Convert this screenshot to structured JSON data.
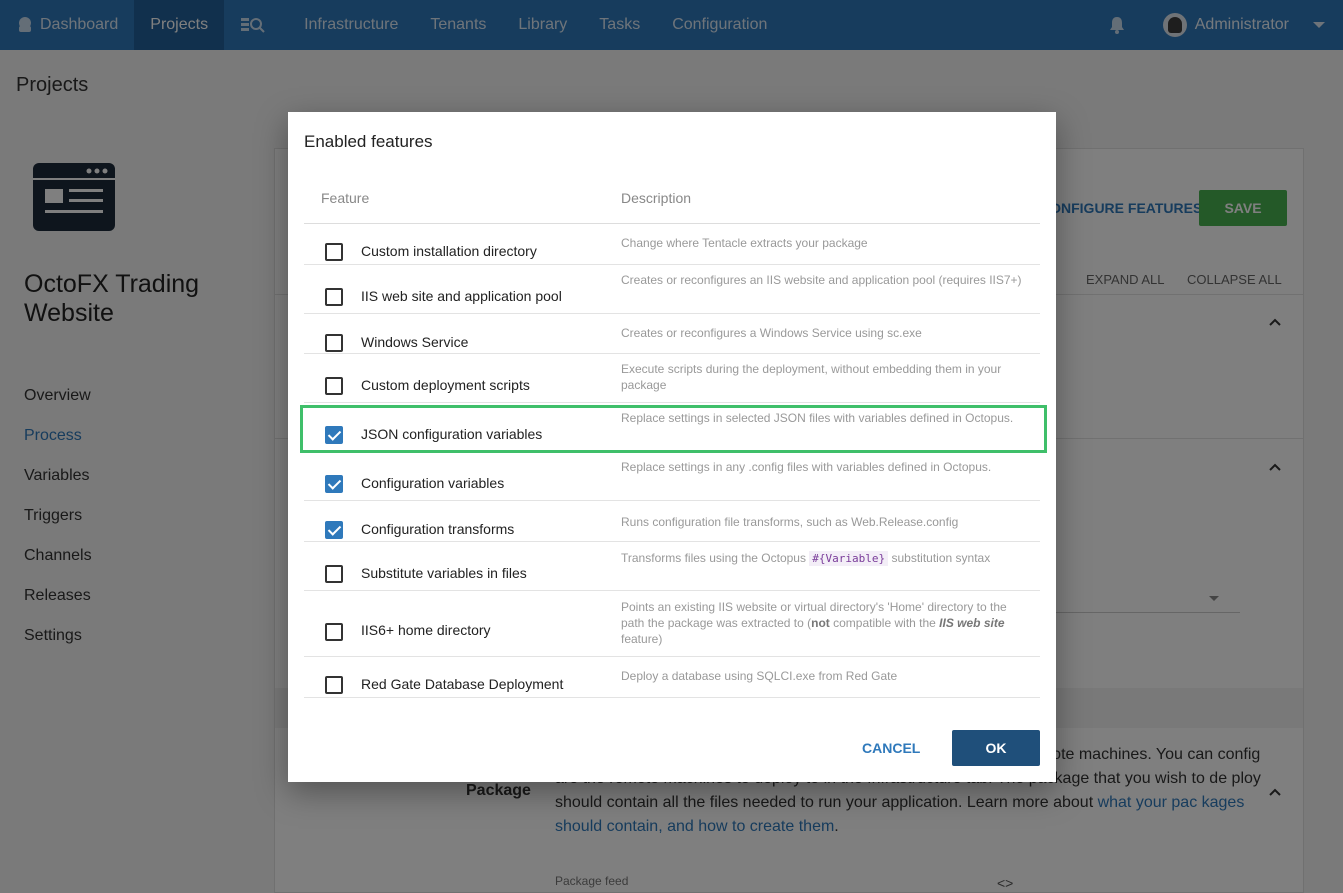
{
  "nav": {
    "items": [
      {
        "label": "Dashboard",
        "icon": "octopus-icon"
      },
      {
        "label": "Projects",
        "active": true
      },
      {
        "label": "",
        "icon": "search-list-icon"
      },
      {
        "label": "Infrastructure"
      },
      {
        "label": "Tenants"
      },
      {
        "label": "Library"
      },
      {
        "label": "Tasks"
      },
      {
        "label": "Configuration"
      }
    ],
    "user": "Administrator",
    "accent": "#2f79bb"
  },
  "page": {
    "title": "Projects"
  },
  "project": {
    "title": "OctoFX Trading Website",
    "menu": [
      "Overview",
      "Process",
      "Variables",
      "Triggers",
      "Channels",
      "Releases",
      "Settings"
    ],
    "active": "Process"
  },
  "main": {
    "configure_features": "CONFIGURE FEATURES",
    "save": "SAVE",
    "expand_all": "EXPAND ALL",
    "collapse_all": "COLLAPSE ALL",
    "package_label": "Package",
    "package_text_1": "Packages are deployed to your deployment targets, which are the remote machines. You can config are the remote machines to deploy to in the Infrastructure tab. The package that you wish to de ploy should contain all the files needed to run your application. Learn more about ",
    "package_link": "what your pac kages should contain, and how to create them",
    "package_feed": "Package feed"
  },
  "dialog": {
    "title": "Enabled features",
    "col_feature": "Feature",
    "col_description": "Description",
    "features": [
      {
        "name": "Custom installation directory",
        "checked": false,
        "desc": "Change where Tentacle extracts your package"
      },
      {
        "name": "IIS web site and application pool",
        "checked": false,
        "desc": "Creates or reconfigures an IIS website and application pool (requires IIS7+)"
      },
      {
        "name": "Windows Service",
        "checked": false,
        "desc": "Creates or reconfigures a Windows Service using sc.exe"
      },
      {
        "name": "Custom deployment scripts",
        "checked": false,
        "desc": "Execute scripts during the deployment, without embedding them in your package"
      },
      {
        "name": "JSON configuration variables",
        "checked": true,
        "desc": "Replace settings in selected JSON files with variables defined in Octopus."
      },
      {
        "name": "Configuration variables",
        "checked": true,
        "desc": "Replace settings in any .config files with variables defined in Octopus."
      },
      {
        "name": "Configuration transforms",
        "checked": true,
        "desc": "Runs configuration file transforms, such as Web.Release.config"
      },
      {
        "name": "Substitute variables in files",
        "checked": false,
        "desc": "Transforms files using the Octopus #{Variable} substitution syntax"
      },
      {
        "name": "IIS6+ home directory",
        "checked": false,
        "desc": "Points an existing IIS website or virtual directory's 'Home' directory to the path the package was extracted to (not compatible with the IIS web site feature)"
      },
      {
        "name": "Red Gate Database Deployment",
        "checked": false,
        "desc": "Deploy a database using SQLCI.exe from Red Gate"
      }
    ],
    "cancel": "CANCEL",
    "ok": "OK"
  }
}
